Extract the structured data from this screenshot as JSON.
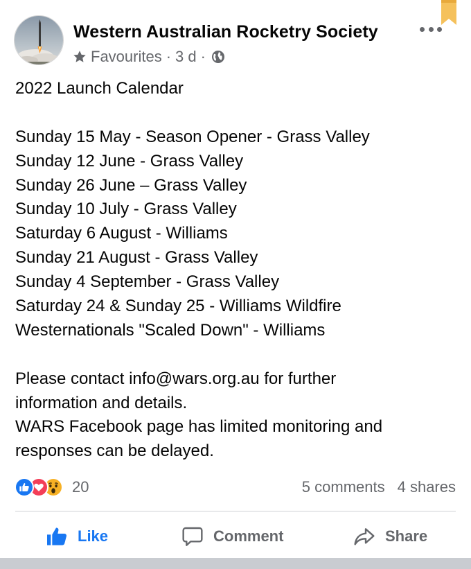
{
  "post": {
    "author": "Western Australian Rocketry Society",
    "favourites_label": "Favourites",
    "time": "3 d",
    "dot": "·",
    "lines": [
      "2022 Launch Calendar",
      "",
      "Sunday 15 May - Season Opener - Grass Valley",
      "Sunday 12 June - Grass Valley",
      "Sunday 26 June – Grass Valley",
      "Sunday 10 July - Grass Valley",
      "Saturday 6 August - Williams",
      "Sunday 21 August - Grass Valley",
      "Sunday 4 September - Grass Valley",
      "Saturday 24 & Sunday 25 - Williams Wildfire",
      "Westernationals \"Scaled Down\" - Williams",
      "",
      "Please contact info@wars.org.au for further",
      "information and details.",
      "WARS Facebook page has limited monitoring and",
      "responses can be delayed."
    ]
  },
  "engagement": {
    "reaction_count": "20",
    "comments": "5 comments",
    "shares": "4 shares"
  },
  "actions": {
    "like": "Like",
    "comment": "Comment",
    "share": "Share"
  },
  "colors": {
    "brand_blue": "#1877f2",
    "secondary_text": "#65676b",
    "love_red": "#f33e58",
    "wow_yellow": "#f7b125",
    "bookmark_gold": "#f5c15c"
  },
  "icons": [
    "bookmark-icon",
    "star-icon",
    "globe-icon",
    "more-options-icon",
    "like-reaction-icon",
    "love-reaction-icon",
    "wow-reaction-icon",
    "thumbs-up-icon",
    "comment-icon",
    "share-icon"
  ]
}
